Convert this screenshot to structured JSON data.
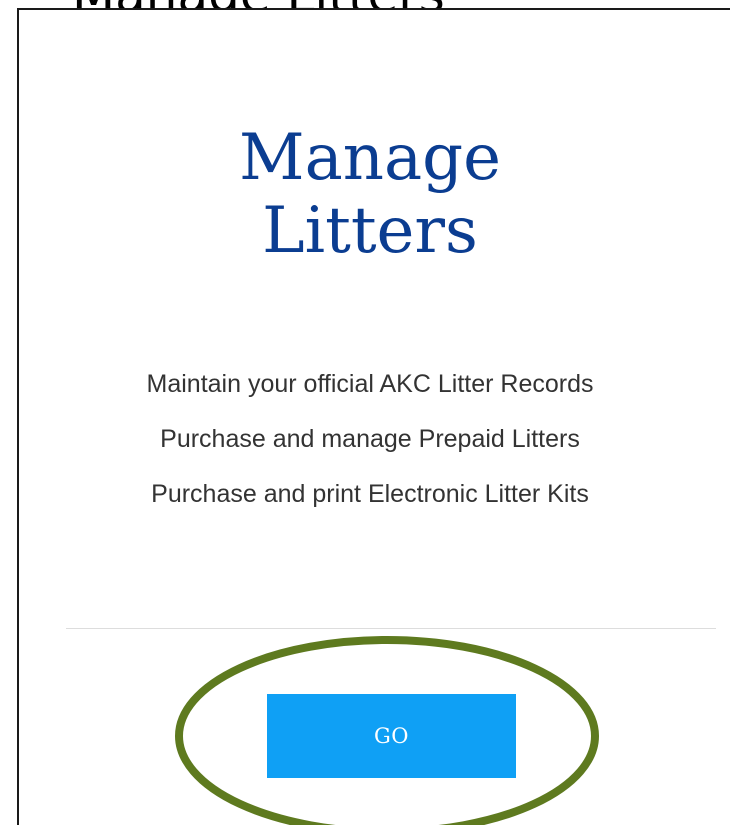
{
  "clipped_heading": "Manage Litters",
  "card": {
    "title_line1": "Manage",
    "title_line2": "Litters",
    "descriptions": [
      "Maintain your official AKC Litter Records",
      "Purchase and manage Prepaid Litters",
      "Purchase and print Electronic Litter Kits"
    ],
    "go_label": "GO"
  },
  "colors": {
    "title": "#0b3d91",
    "button": "#0fa0f5",
    "annotation_ellipse": "#5e7a1f",
    "border": "#1a1a1a"
  }
}
